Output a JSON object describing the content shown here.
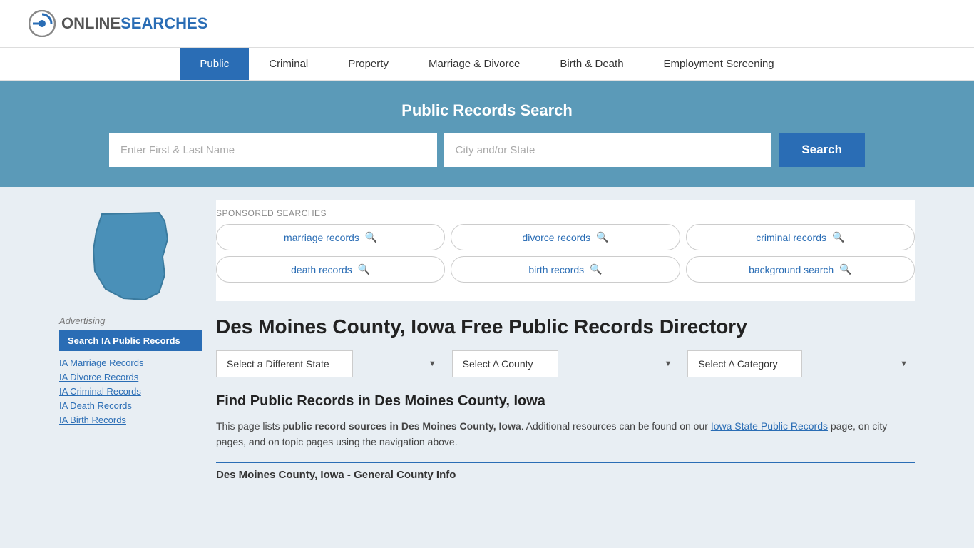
{
  "header": {
    "logo_online": "ONLINE",
    "logo_searches": "SEARCHES"
  },
  "nav": {
    "items": [
      {
        "label": "Public",
        "active": true
      },
      {
        "label": "Criminal",
        "active": false
      },
      {
        "label": "Property",
        "active": false
      },
      {
        "label": "Marriage & Divorce",
        "active": false
      },
      {
        "label": "Birth & Death",
        "active": false
      },
      {
        "label": "Employment Screening",
        "active": false
      }
    ]
  },
  "search_banner": {
    "title": "Public Records Search",
    "name_placeholder": "Enter First & Last Name",
    "location_placeholder": "City and/or State",
    "button_label": "Search"
  },
  "sponsored": {
    "label": "SPONSORED SEARCHES",
    "items": [
      {
        "text": "marriage records"
      },
      {
        "text": "divorce records"
      },
      {
        "text": "criminal records"
      },
      {
        "text": "death records"
      },
      {
        "text": "birth records"
      },
      {
        "text": "background search"
      }
    ]
  },
  "page": {
    "title": "Des Moines County, Iowa Free Public Records Directory",
    "dropdowns": {
      "state": "Select a Different State",
      "county": "Select A County",
      "category": "Select A Category"
    },
    "find_title": "Find Public Records in Des Moines County, Iowa",
    "find_desc_part1": "This page lists ",
    "find_desc_bold": "public record sources in Des Moines County, Iowa",
    "find_desc_part2": ". Additional resources can be found on our ",
    "find_desc_link": "Iowa State Public Records",
    "find_desc_part3": " page, on city pages, and on topic pages using the navigation above.",
    "general_info": "Des Moines County, Iowa - General County Info"
  },
  "sidebar": {
    "advertising_label": "Advertising",
    "search_btn": "Search IA Public Records",
    "links": [
      {
        "text": "IA Marriage Records"
      },
      {
        "text": "IA Divorce Records"
      },
      {
        "text": "IA Criminal Records"
      },
      {
        "text": "IA Death Records"
      },
      {
        "text": "IA Birth Records"
      }
    ]
  }
}
